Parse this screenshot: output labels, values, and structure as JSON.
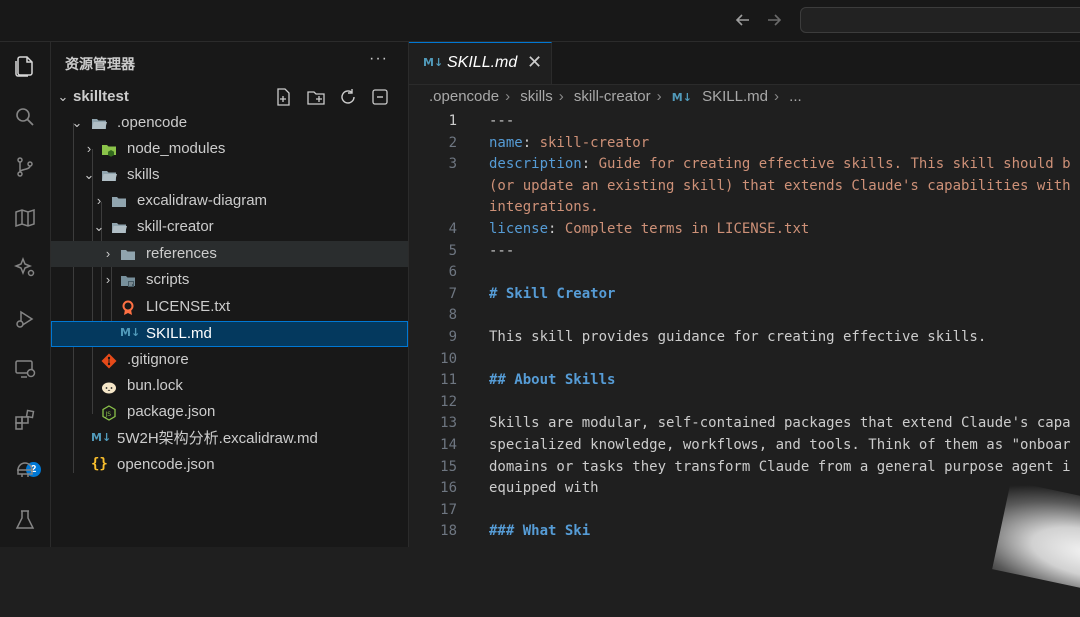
{
  "explorer": {
    "title": "资源管理器",
    "more": "···",
    "tree": [
      {
        "label": "skilltest",
        "type": "root",
        "chev": "down"
      },
      {
        "label": ".opencode",
        "type": "folder-open",
        "chev": "down"
      },
      {
        "label": "node_modules",
        "type": "folder-node",
        "chev": "right"
      },
      {
        "label": "skills",
        "type": "folder-open",
        "chev": "down"
      },
      {
        "label": "excalidraw-diagram",
        "type": "folder",
        "chev": "right"
      },
      {
        "label": "skill-creator",
        "type": "folder-open",
        "chev": "down"
      },
      {
        "label": "references",
        "type": "folder",
        "chev": "right"
      },
      {
        "label": "scripts",
        "type": "folder-scripts",
        "chev": "right"
      },
      {
        "label": "LICENSE.txt",
        "type": "license"
      },
      {
        "label": "SKILL.md",
        "type": "markdown"
      },
      {
        "label": ".gitignore",
        "type": "git"
      },
      {
        "label": "bun.lock",
        "type": "bun"
      },
      {
        "label": "package.json",
        "type": "json-js"
      },
      {
        "label": "5W2H架构分析.excalidraw.md",
        "type": "markdown"
      },
      {
        "label": "opencode.json",
        "type": "json"
      }
    ]
  },
  "activity_bar": {
    "extensions_badge": "2"
  },
  "tab": {
    "icon": "M↓",
    "label": "SKILL.md",
    "close": "✕"
  },
  "breadcrumb": [
    ".opencode",
    "skills",
    "skill-creator",
    "SKILL.md",
    "..."
  ],
  "editor": {
    "lines": [
      {
        "n": "1",
        "parts": [
          [
            "t",
            "---"
          ]
        ]
      },
      {
        "n": "2",
        "parts": [
          [
            "k",
            "name"
          ],
          [
            "t",
            ": "
          ],
          [
            "s",
            "skill-creator"
          ]
        ]
      },
      {
        "n": "3",
        "parts": [
          [
            "k",
            "description"
          ],
          [
            "t",
            ": "
          ],
          [
            "s",
            "Guide for creating effective skills. This skill should b"
          ]
        ]
      },
      {
        "n": "",
        "parts": [
          [
            "s",
            "(or update an existing skill) that extends Claude's capabilities with"
          ]
        ]
      },
      {
        "n": "",
        "parts": [
          [
            "s",
            "integrations."
          ]
        ]
      },
      {
        "n": "4",
        "parts": [
          [
            "k",
            "license"
          ],
          [
            "t",
            ": "
          ],
          [
            "s",
            "Complete terms in LICENSE.txt"
          ]
        ]
      },
      {
        "n": "5",
        "parts": [
          [
            "t",
            "---"
          ]
        ]
      },
      {
        "n": "6",
        "parts": []
      },
      {
        "n": "7",
        "parts": [
          [
            "h",
            "# Skill Creator"
          ]
        ]
      },
      {
        "n": "8",
        "parts": []
      },
      {
        "n": "9",
        "parts": [
          [
            "t",
            "This skill provides guidance for creating effective skills."
          ]
        ]
      },
      {
        "n": "10",
        "parts": []
      },
      {
        "n": "11",
        "parts": [
          [
            "h",
            "## About Skills"
          ]
        ]
      },
      {
        "n": "12",
        "parts": []
      },
      {
        "n": "13",
        "parts": [
          [
            "t",
            "Skills are modular, self-contained packages that extend Claude's capa"
          ]
        ]
      },
      {
        "n": "14",
        "parts": [
          [
            "t",
            "specialized knowledge, workflows, and tools. Think of them as \"onboar"
          ]
        ]
      },
      {
        "n": "15",
        "parts": [
          [
            "t",
            "domains or tasks they transform Claude from a general purpose agent i"
          ]
        ]
      },
      {
        "n": "16",
        "parts": [
          [
            "t",
            "equipped with"
          ]
        ]
      },
      {
        "n": "17",
        "parts": []
      },
      {
        "n": "18",
        "parts": [
          [
            "h",
            "### What Ski"
          ]
        ]
      }
    ]
  }
}
